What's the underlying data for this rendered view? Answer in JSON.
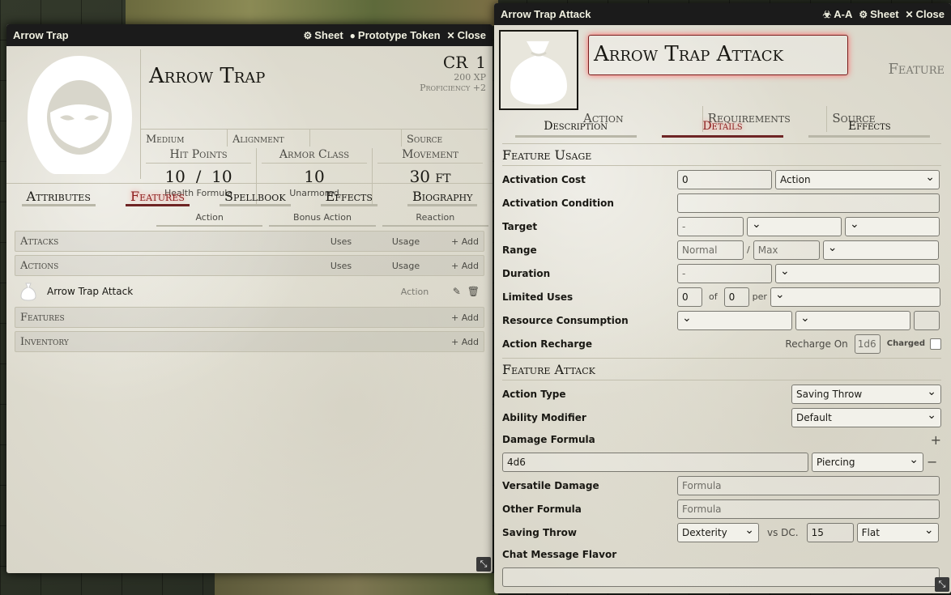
{
  "actor_sheet": {
    "title": "Arrow Trap",
    "header_buttons": {
      "sheet": "Sheet",
      "prototype_token": "Prototype Token",
      "close": "Close"
    },
    "name": "Arrow Trap",
    "cr_label": "CR",
    "cr_value": "1",
    "xp": "200 XP",
    "proficiency": "Proficiency +2",
    "traits": {
      "size": "Medium",
      "alignment": "Alignment",
      "blank": "",
      "source": "Source"
    },
    "stats": {
      "hp_label": "Hit Points",
      "hp_current": "10",
      "hp_sep": "/",
      "hp_max": "10",
      "hp_formula": "Health Formula",
      "ac_label": "Armor Class",
      "ac_value": "10",
      "ac_type": "Unarmored",
      "move_label": "Movement",
      "move_value": "30 ft"
    },
    "tabs": [
      "Attributes",
      "Features",
      "Spellbook",
      "Effects",
      "Biography"
    ],
    "action_headers": [
      "Action",
      "Bonus Action",
      "Reaction"
    ],
    "sections": {
      "attacks": {
        "label": "Attacks",
        "uses": "Uses",
        "usage": "Usage",
        "add": "Add"
      },
      "actions": {
        "label": "Actions",
        "uses": "Uses",
        "usage": "Usage",
        "add": "Add"
      },
      "features": {
        "label": "Features",
        "add": "Add"
      },
      "inventory": {
        "label": "Inventory",
        "add": "Add"
      }
    },
    "actions_items": [
      {
        "name": "Arrow Trap Attack",
        "usage": "Action"
      }
    ]
  },
  "item_sheet": {
    "title": "Arrow Trap Attack",
    "header_buttons": {
      "aa": "A-A",
      "sheet": "Sheet",
      "close": "Close"
    },
    "name": "Arrow Trap Attack",
    "type": "Feature",
    "props": {
      "action": "Action",
      "requirements": "Requirements",
      "source": "Source"
    },
    "tabs": [
      "Description",
      "Details",
      "Effects"
    ],
    "feature_usage": {
      "title": "Feature Usage",
      "activation_cost": {
        "label": "Activation Cost",
        "value": "0",
        "type": "Action"
      },
      "activation_condition": {
        "label": "Activation Condition",
        "value": ""
      },
      "target": {
        "label": "Target",
        "value": "-"
      },
      "range": {
        "label": "Range",
        "normal_placeholder": "Normal",
        "sep": "/",
        "max_placeholder": "Max"
      },
      "duration": {
        "label": "Duration",
        "value": "-"
      },
      "limited_uses": {
        "label": "Limited Uses",
        "value": "0",
        "of": "of",
        "max": "0",
        "per": "per"
      },
      "resource_consumption": {
        "label": "Resource Consumption"
      },
      "action_recharge": {
        "label": "Action Recharge",
        "recharge_on": "Recharge On",
        "die": "1d6",
        "charged": "Charged"
      }
    },
    "feature_attack": {
      "title": "Feature Attack",
      "action_type": {
        "label": "Action Type",
        "value": "Saving Throw"
      },
      "ability_modifier": {
        "label": "Ability Modifier",
        "value": "Default"
      },
      "damage_formula": {
        "label": "Damage Formula",
        "formula": "4d6",
        "type": "Piercing",
        "plus": "+",
        "minus": "−"
      },
      "versatile_damage": {
        "label": "Versatile Damage",
        "placeholder": "Formula"
      },
      "other_formula": {
        "label": "Other Formula",
        "placeholder": "Formula"
      },
      "saving_throw": {
        "label": "Saving Throw",
        "ability": "Dexterity",
        "vs_dc": "vs DC.",
        "dc": "15",
        "scaling": "Flat"
      },
      "chat_flavor": {
        "label": "Chat Message Flavor",
        "value": ""
      }
    }
  },
  "colors": {
    "accent": "#8c1d1d",
    "header_bg": "#1b1b1b",
    "parchment": "#e8e6dc"
  }
}
